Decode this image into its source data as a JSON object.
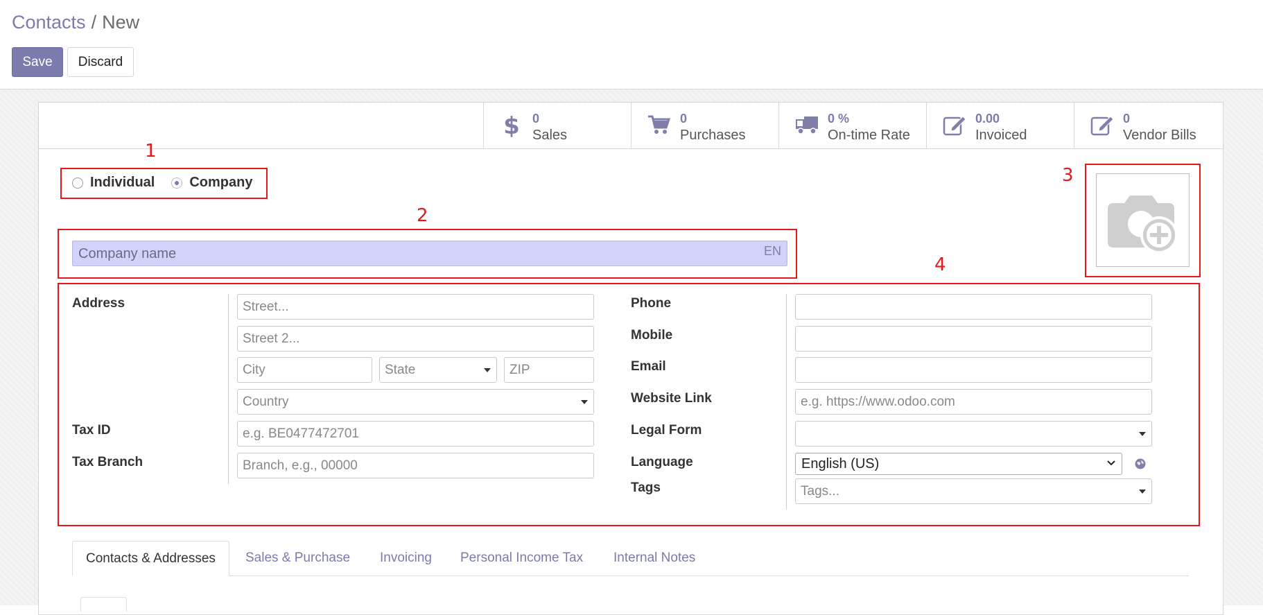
{
  "breadcrumb": {
    "parent": "Contacts",
    "separator": "/",
    "current": "New"
  },
  "toolbar": {
    "save_label": "Save",
    "discard_label": "Discard"
  },
  "stats": [
    {
      "icon": "dollar-icon",
      "value": "0",
      "label": "Sales"
    },
    {
      "icon": "cart-icon",
      "value": "0",
      "label": "Purchases"
    },
    {
      "icon": "truck-icon",
      "value": "0 %",
      "label": "On-time Rate"
    },
    {
      "icon": "edit-icon",
      "value": "0.00",
      "label": "Invoiced"
    },
    {
      "icon": "edit-icon",
      "value": "0",
      "label": "Vendor Bills"
    }
  ],
  "annotations": [
    "1",
    "2",
    "3",
    "4"
  ],
  "company_type": {
    "individual_label": "Individual",
    "company_label": "Company",
    "selected": "Company"
  },
  "name_field": {
    "placeholder": "Company name",
    "lang": "EN"
  },
  "address": {
    "label": "Address",
    "street_placeholder": "Street...",
    "street2_placeholder": "Street 2...",
    "city_placeholder": "City",
    "state_placeholder": "State",
    "zip_placeholder": "ZIP",
    "country_placeholder": "Country"
  },
  "tax_id": {
    "label": "Tax ID",
    "placeholder": "e.g. BE0477472701"
  },
  "tax_branch": {
    "label": "Tax Branch",
    "placeholder": "Branch, e.g., 00000"
  },
  "phone": {
    "label": "Phone",
    "value": ""
  },
  "mobile": {
    "label": "Mobile",
    "value": ""
  },
  "email": {
    "label": "Email",
    "value": ""
  },
  "website": {
    "label": "Website Link",
    "placeholder": "e.g. https://www.odoo.com"
  },
  "legal_form": {
    "label": "Legal Form",
    "value": ""
  },
  "language": {
    "label": "Language",
    "value": "English (US)"
  },
  "tags": {
    "label": "Tags",
    "placeholder": "Tags..."
  },
  "tabs": [
    "Contacts & Addresses",
    "Sales & Purchase",
    "Invoicing",
    "Personal Income Tax",
    "Internal Notes"
  ],
  "colors": {
    "accent": "#7c7bad",
    "annotation": "#e5161c",
    "name_field_bg": "#d2d2fb"
  }
}
